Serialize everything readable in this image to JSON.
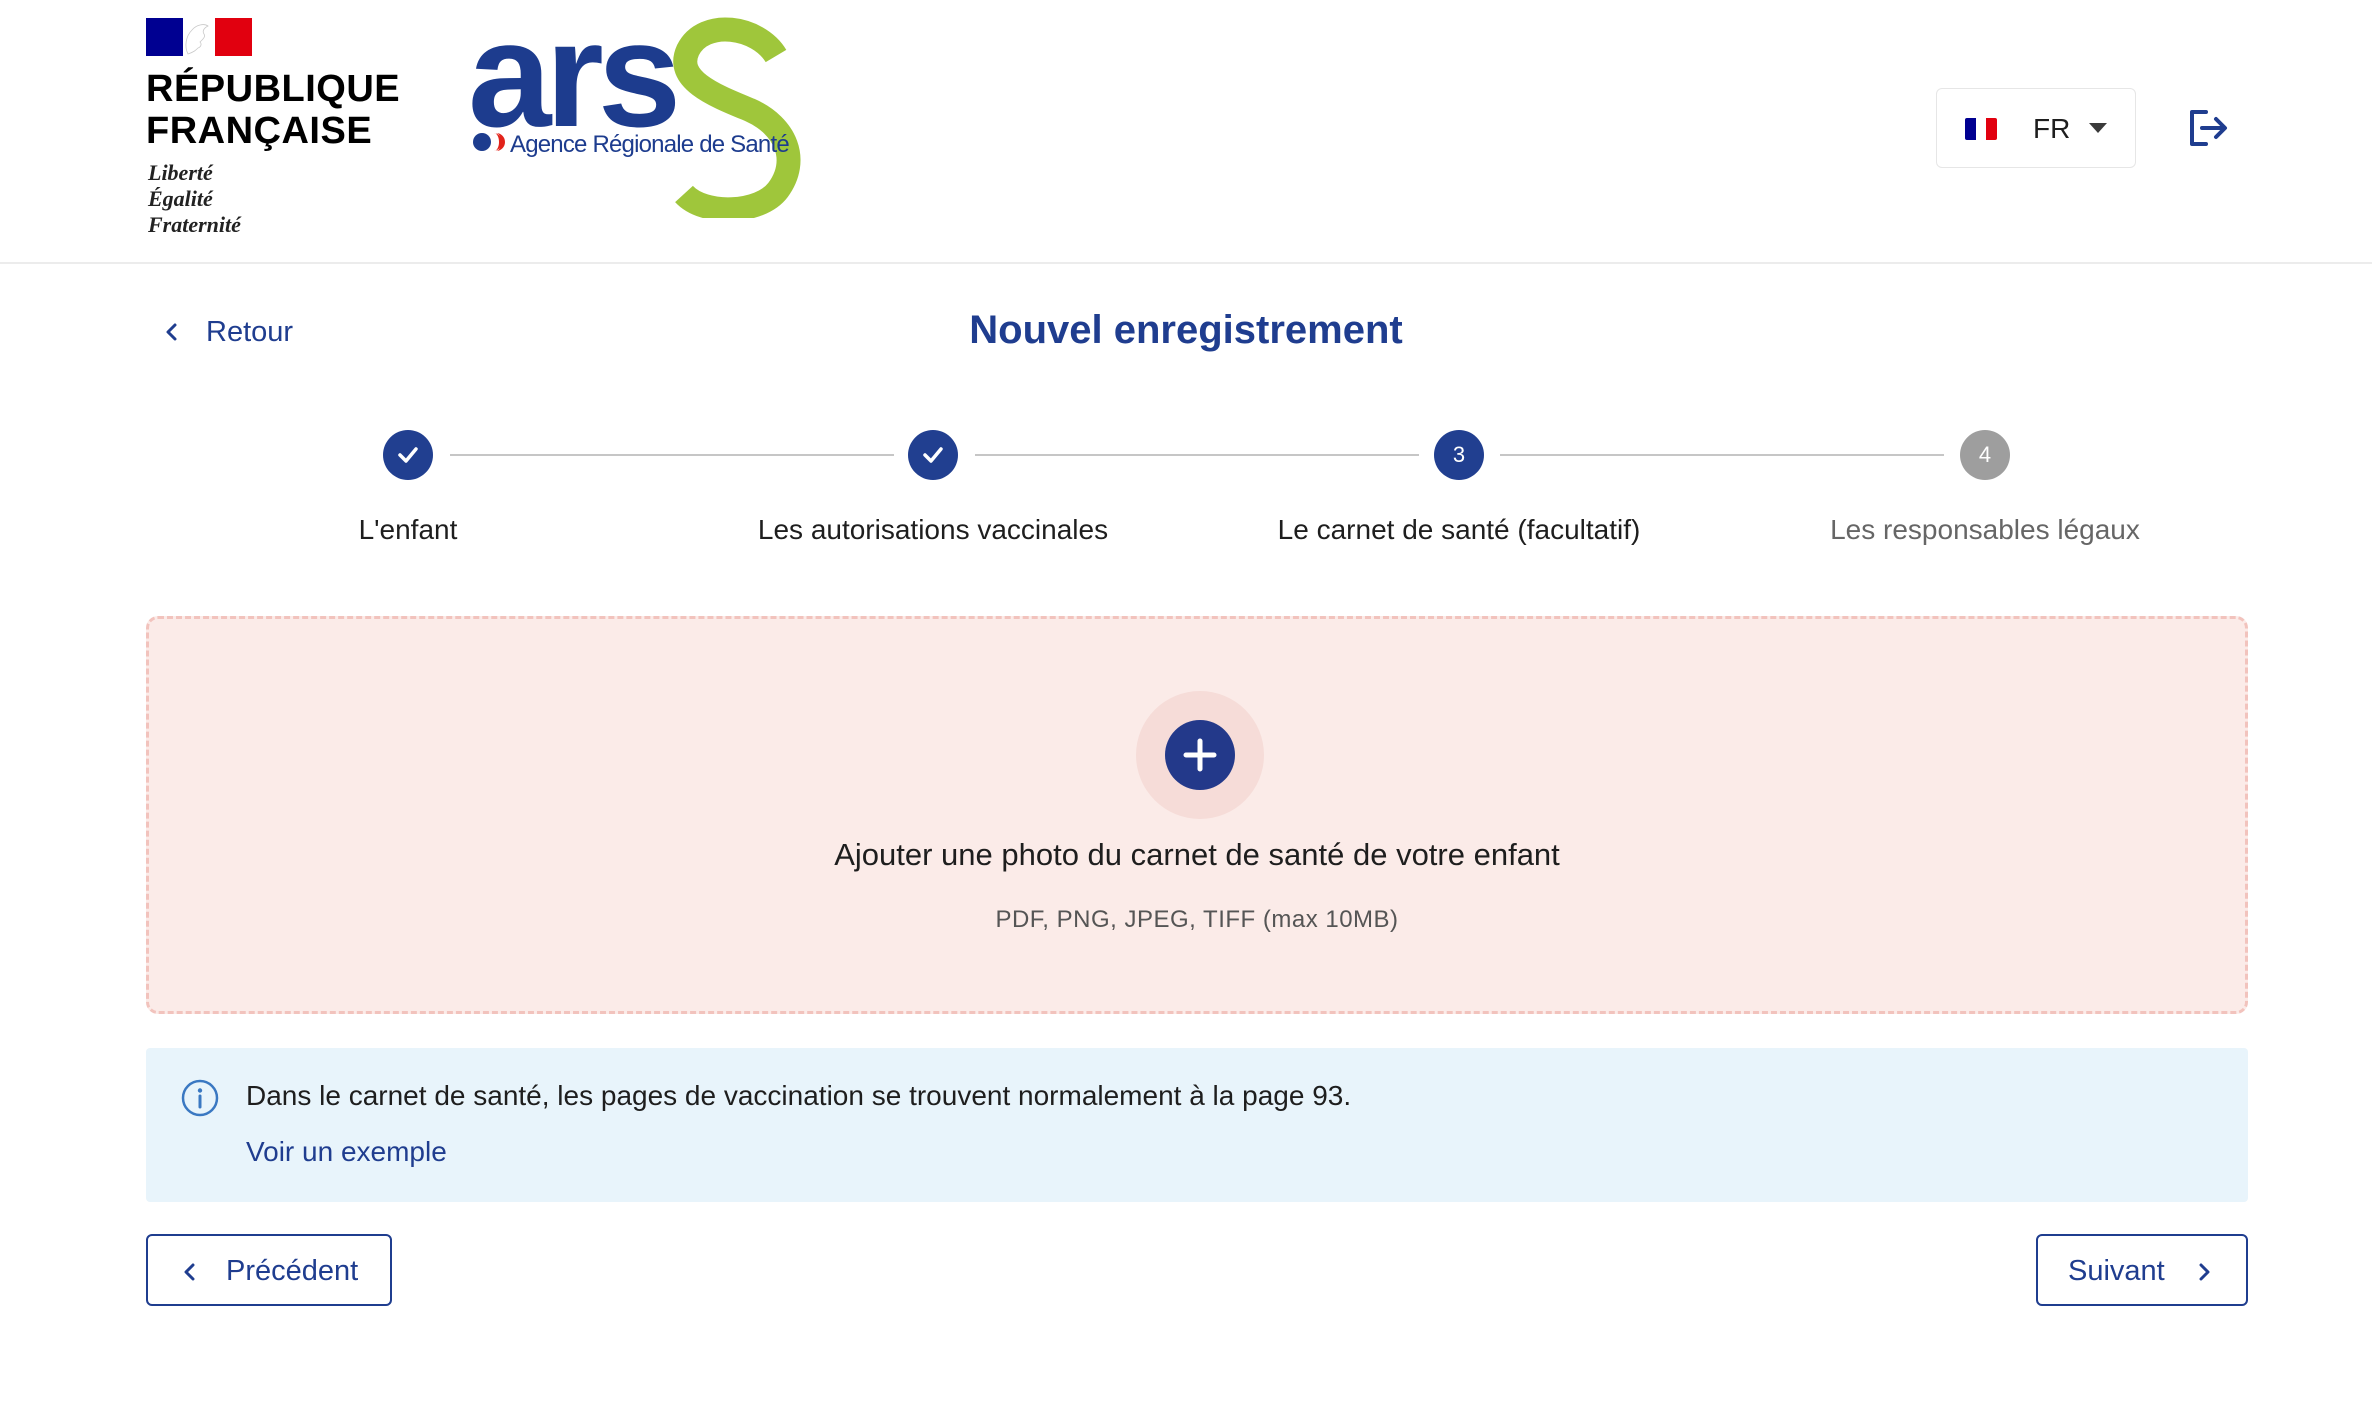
{
  "header": {
    "republique": {
      "name_line1": "RÉPUBLIQUE",
      "name_line2": "FRANÇAISE",
      "motto_line1": "Liberté",
      "motto_line2": "Égalité",
      "motto_line3": "Fraternité"
    },
    "ars": {
      "logo_letters": "ars",
      "tagline": "Agence Régionale de Santé",
      "colors": {
        "blue": "#1d3c8e",
        "green": "#9fc63b",
        "red": "#e2231a"
      }
    },
    "language": {
      "selected": "FR",
      "flag_icon": "french-flag-icon",
      "caret_icon": "caret-down-icon"
    },
    "logout_icon": "logout-icon"
  },
  "nav": {
    "back_label": "Retour",
    "back_icon": "chevron-left-icon"
  },
  "page": {
    "title": "Nouvel enregistrement"
  },
  "stepper": {
    "steps": [
      {
        "number": "1",
        "label": "L'enfant",
        "status": "done"
      },
      {
        "number": "2",
        "label": "Les autorisations vaccinales",
        "status": "done"
      },
      {
        "number": "3",
        "label": "Le carnet de santé (facultatif)",
        "status": "current"
      },
      {
        "number": "4",
        "label": "Les responsables légaux",
        "status": "todo"
      }
    ]
  },
  "upload": {
    "title": "Ajouter une photo du carnet de santé de votre enfant",
    "hint": "PDF, PNG, JPEG, TIFF (max 10MB)",
    "icon": "plus-icon"
  },
  "info": {
    "icon": "info-icon",
    "text": "Dans le carnet de santé, les pages de vaccination se trouvent normalement à la page 93.",
    "link": "Voir un exemple"
  },
  "footer": {
    "prev_label": "Précédent",
    "next_label": "Suivant"
  },
  "colors": {
    "primary": "#1f3d8f",
    "upload_bg": "#fbebe8",
    "upload_border": "#f2c3bd",
    "info_bg": "#e8f4fb",
    "step_todo": "#9e9e9e"
  }
}
